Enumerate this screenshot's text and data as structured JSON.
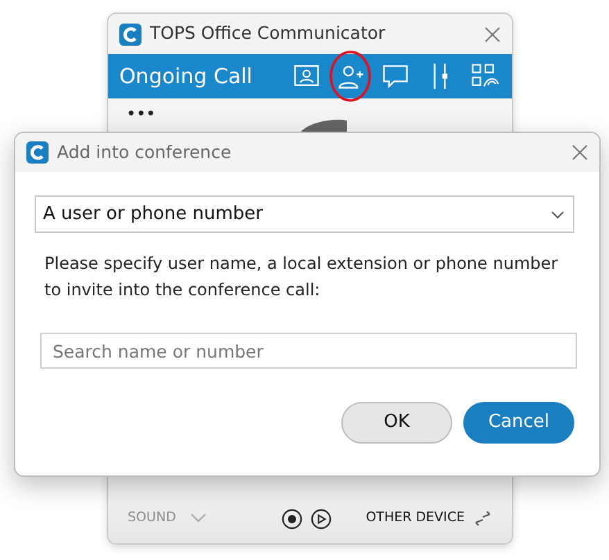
{
  "main_window": {
    "title": "TOPS Office Communicator",
    "header": "Ongoing Call",
    "toolbar": [
      {
        "highlighted": false
      },
      {
        "highlighted": true
      },
      {
        "highlighted": false
      },
      {
        "highlighted": false
      },
      {
        "highlighted": false
      }
    ],
    "more": "•••",
    "sound": {
      "label": "SOUND",
      "disabled": true
    },
    "other_device": "OTHER DEVICE"
  },
  "dialog": {
    "title": "Add into conference",
    "select": "A user or phone number",
    "message": "Please specify user name, a local extension or phone number to invite into the conference call:",
    "search": {
      "placeholder": "Search name or number"
    },
    "buttons": [
      {
        "label": "OK",
        "kind": "secondary"
      },
      {
        "label": "Cancel",
        "kind": "primary"
      }
    ]
  }
}
